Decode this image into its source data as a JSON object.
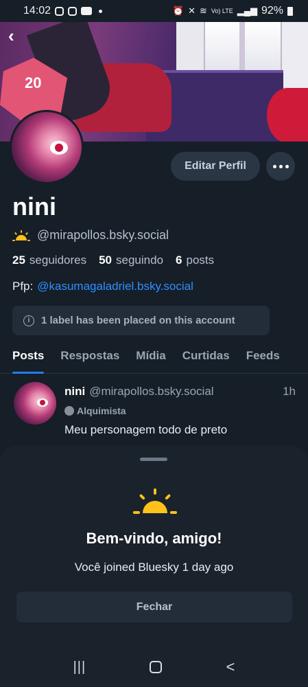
{
  "status_bar": {
    "time": "14:02",
    "signal_text": "Vo) LTE",
    "battery": "92%"
  },
  "icons": {
    "back": "back-arrow-icon",
    "more": "more-dots-icon",
    "info": "info-icon",
    "sun": "sun-icon"
  },
  "profile": {
    "display_name": "nini",
    "handle": "@mirapollos.bsky.social",
    "stats": {
      "followers_count": "25",
      "followers_label": "seguidores",
      "following_count": "50",
      "following_label": "seguindo",
      "posts_count": "6",
      "posts_label": "posts"
    },
    "bio_prefix": "Pfp:",
    "bio_link": "@kasumagaladriel.bsky.social",
    "label_notice": "1 label has been placed on this account",
    "edit_button": "Editar Perfil"
  },
  "tabs": [
    {
      "label": "Posts",
      "active": true
    },
    {
      "label": "Respostas",
      "active": false
    },
    {
      "label": "Mídia",
      "active": false
    },
    {
      "label": "Curtidas",
      "active": false
    },
    {
      "label": "Feeds",
      "active": false
    }
  ],
  "post": {
    "author": "nini",
    "handle": "@mirapollos.bsky.social",
    "time": "1h",
    "badge": "Alquimista",
    "text": "Meu personagem todo de preto"
  },
  "banner": {
    "dice_label": "20"
  },
  "welcome_sheet": {
    "title": "Bem-vindo, amigo!",
    "subtitle": "Você joined Bluesky 1 day ago",
    "close_button": "Fechar"
  },
  "nav": {
    "recent": "|||",
    "back": "<"
  },
  "colors": {
    "background": "#161e27",
    "link": "#2f8fff",
    "accent_tab": "#1f7df0",
    "sun": "#ffc21a"
  }
}
